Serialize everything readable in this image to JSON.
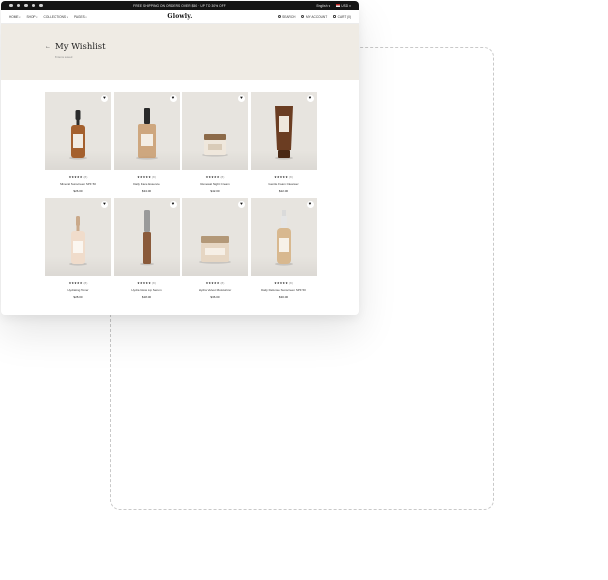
{
  "announcement": {
    "promo": "FREE SHIPPING ON ORDERS OVER $50 · UP TO 30% OFF",
    "region": "English ▾",
    "currency": "USD ▾"
  },
  "header": {
    "logo": "Glowly.",
    "nav": [
      "HOME",
      "SHOP",
      "COLLECTIONS",
      "PAGES"
    ],
    "utils": {
      "search": "SEARCH",
      "account": "MY ACCOUNT",
      "cart": "CART (0)"
    }
  },
  "hero": {
    "title": "My Wishlist",
    "count": "8 items saved"
  },
  "products": [
    {
      "name": "Mineral Sunscreen SPF 50",
      "stars": "★★★★★",
      "reviews": "(8)",
      "price": "$26.00",
      "kind": "dropper-amber"
    },
    {
      "name": "Daily Face Essence",
      "stars": "★★★★★",
      "reviews": "(8)",
      "price": "$34.00",
      "kind": "serum-square"
    },
    {
      "name": "Renewal Night Cream",
      "stars": "★★★★★",
      "reviews": "(8)",
      "price": "$42.00",
      "kind": "jar-small"
    },
    {
      "name": "Gentle Foam Cleanser",
      "stars": "★★★★★",
      "reviews": "(8)",
      "price": "$22.00",
      "kind": "tube-brown"
    },
    {
      "name": "Hydrating Toner",
      "stars": "★★★★★",
      "reviews": "(8)",
      "price": "$28.00",
      "kind": "dropper-clear"
    },
    {
      "name": "Hydra Glow Lip Serum",
      "stars": "★★★★★",
      "reviews": "(8)",
      "price": "$18.00",
      "kind": "tube-tall"
    },
    {
      "name": "Hydra Velvet Moisturizer",
      "stars": "★★★★★",
      "reviews": "(8)",
      "price": "$36.00",
      "kind": "jar-wide"
    },
    {
      "name": "Daily Defense Sunscreen SPF 50",
      "stars": "★★★★★",
      "reviews": "(8)",
      "price": "$30.00",
      "kind": "spray"
    }
  ],
  "icons": [
    "wishlist-heart-icon",
    "search-icon",
    "account-icon",
    "cart-icon",
    "back-arrow-icon"
  ],
  "colors": {
    "hero_bg": "#efebe4",
    "topbar_bg": "#141414",
    "card_bg": "#e7e4df"
  }
}
